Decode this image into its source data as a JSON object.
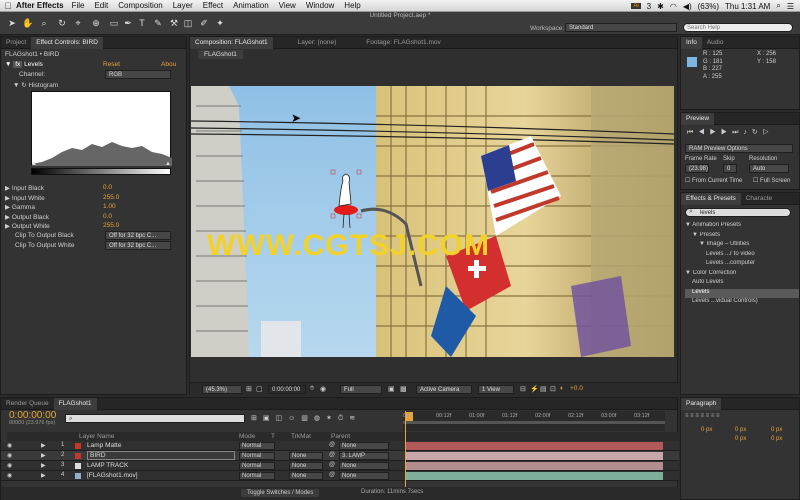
{
  "menubar": {
    "apple": "",
    "app": "After Effects",
    "items": [
      "File",
      "Edit",
      "Composition",
      "Layer",
      "Effect",
      "Animation",
      "View",
      "Window",
      "Help"
    ],
    "adobe": "Ai",
    "badge": "3",
    "battery": "(63%)",
    "time": "Thu 1:31 AM"
  },
  "window": {
    "title": "Untitled Project.aep *",
    "workspace_label": "Workspace:",
    "workspace_value": "Standard",
    "search_placeholder": "Search Help"
  },
  "left": {
    "tabs": [
      "Project",
      "Effect Controls: BIRD"
    ],
    "path": "FLAGshot1 • BIRD",
    "effect_name": "Levels",
    "reset": "Reset",
    "about": "Abou",
    "channel_label": "Channel:",
    "channel_value": "RGB",
    "histogram_label": "Histogram",
    "params": [
      {
        "label": "Input Black",
        "value": "0.0"
      },
      {
        "label": "Input White",
        "value": "255.0"
      },
      {
        "label": "Gamma",
        "value": "1.00"
      },
      {
        "label": "Output Black",
        "value": "0.0"
      },
      {
        "label": "Output White",
        "value": "255.0"
      }
    ],
    "clip": [
      {
        "label": "Clip To Output Black",
        "value": "Off for 32 bpc C..."
      },
      {
        "label": "Clip To Output White",
        "value": "Off for 32 bpc C..."
      }
    ]
  },
  "comp": {
    "tabs": [
      "Composition: FLAGshot1",
      "Layer: (none)",
      "Footage: FLAGshot1.mov"
    ],
    "subtab": "FLAGshot1",
    "watermark": "WWW.CGTSJ.COM",
    "footer": {
      "zoom": "(45.3%)",
      "time": "0:00:00:00",
      "res": "Full",
      "camera": "Active Camera",
      "view": "1 View",
      "exposure": "+0.0"
    }
  },
  "info": {
    "tabs": [
      "Info",
      "Audio"
    ],
    "r": "R : 125",
    "g": "G : 181",
    "b": "B : 227",
    "a": "A : 255",
    "x": "X : 256",
    "y": "Y : 158",
    "swatch": "#7db5e3"
  },
  "preview": {
    "tab": "Preview",
    "ram": "RAM Preview Options",
    "frame_rate_label": "Frame Rate",
    "skip_label": "Skip",
    "resolution_label": "Resolution",
    "frame_rate": "(23.98)",
    "skip": "0",
    "resolution": "Auto",
    "from_current": "From Current Time",
    "full_screen": "Full Screen"
  },
  "effects": {
    "tabs": [
      "Effects & Presets",
      "Characte"
    ],
    "search": "levels",
    "tree": [
      {
        "t": "▼ Animation Presets",
        "i": 0
      },
      {
        "t": "▼ Presets",
        "i": 1
      },
      {
        "t": "▼ Image – Utilities",
        "i": 2
      },
      {
        "t": "Levels ...r to video",
        "i": 3
      },
      {
        "t": "Levels ...computer",
        "i": 3
      },
      {
        "t": "▼ Color Correction",
        "i": 0
      },
      {
        "t": "Auto Levels",
        "i": 1
      },
      {
        "t": "Levels",
        "i": 1,
        "sel": true
      },
      {
        "t": "Levels ...vidual Controls)",
        "i": 1
      }
    ]
  },
  "paragraph": {
    "tab": "Paragraph",
    "px": [
      "0 px",
      "0 px",
      "0 px",
      "0 px",
      "0 px"
    ]
  },
  "timeline": {
    "tabs": [
      "Render Queue",
      "FLAGshot1"
    ],
    "timecode": "0:00:00:00",
    "fps": "00000 (23.976 fps)",
    "headers": {
      "name": "Layer Name",
      "mode": "Mode",
      "trkmat": "TrkMat",
      "parent": "Parent",
      "t": "T"
    },
    "ruler": [
      "00f",
      "00:12f",
      "01:00f",
      "01:12f",
      "02:00f",
      "02:12f",
      "03:00f",
      "03:12f"
    ],
    "layers": [
      {
        "n": "1",
        "name": "Lamp Matte",
        "mode": "Normal",
        "trk": "",
        "parent": "None",
        "color": "#c0392b"
      },
      {
        "n": "2",
        "name": "BIRD",
        "mode": "Normal",
        "trk": "None",
        "parent": "3. LAMP",
        "color": "#c0392b"
      },
      {
        "n": "3",
        "name": "LAMP TRACK",
        "mode": "Normal",
        "trk": "None",
        "parent": "None",
        "color": "#dddddd"
      },
      {
        "n": "4",
        "name": "[FLAGshot1.mov]",
        "mode": "Normal",
        "trk": "None",
        "parent": "None",
        "color": "#8fb0c8"
      }
    ],
    "toggle": "Toggle Switches / Modes",
    "duration": "Duration: 11mins 7secs"
  }
}
